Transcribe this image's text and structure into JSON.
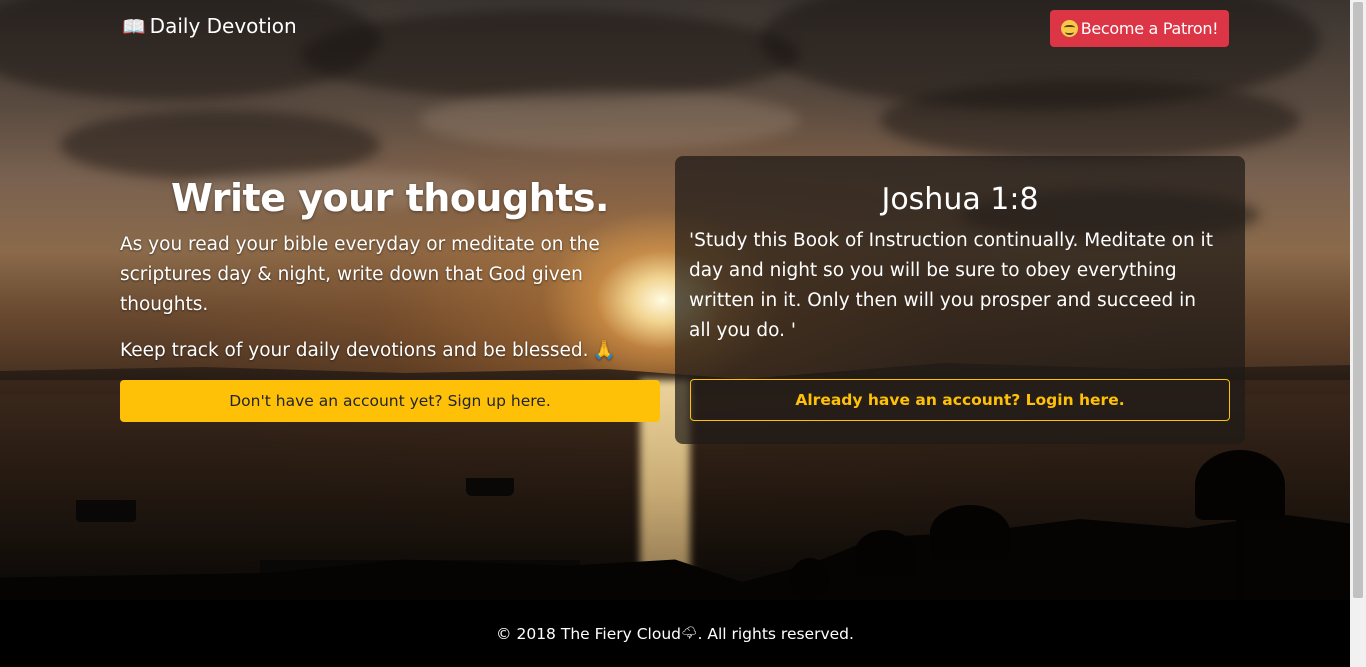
{
  "navbar": {
    "brand_icon": "open-book-icon",
    "brand_label": "Daily Devotion",
    "patron_icon": "smiling-face-with-halo-icon",
    "patron_label": "Become a Patron!"
  },
  "hero": {
    "headline": "Write your thoughts.",
    "paragraph_1": "As you read your bible everyday or meditate on the scriptures day & night, write down that God given thoughts.",
    "paragraph_2": "Keep track of your daily devotions and be blessed.",
    "pray_glyph": "🙏",
    "signup_label": "Don't have an account yet? Sign up here."
  },
  "verse_card": {
    "reference": "Joshua 1:8",
    "text": "'Study this Book of Instruction continually. Meditate on it day and night so you will be sure to obey everything written in it. Only then will you prosper and succeed in all you do. '",
    "login_label": "Already have an account? Login here."
  },
  "footer": {
    "copyright_prefix": "© 2018 The Fiery Cloud",
    "cloud_glyph": "🌩",
    "copyright_suffix": ". All rights reserved."
  },
  "colors": {
    "patron_button": "#dc3545",
    "accent_yellow": "#ffc107",
    "footer_background": "#000000"
  }
}
